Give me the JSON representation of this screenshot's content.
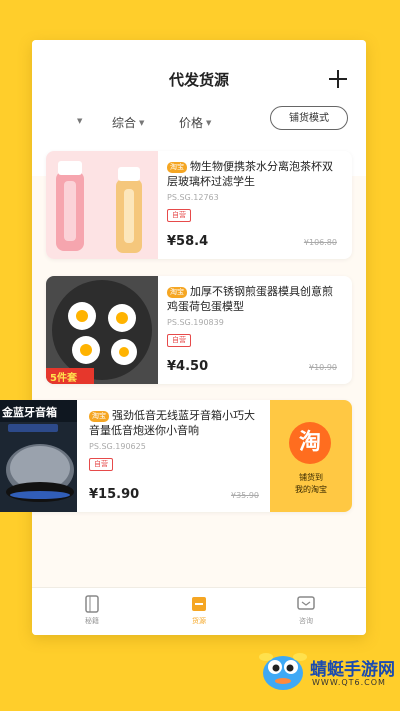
{
  "header": {
    "title": "代发货源"
  },
  "filters": {
    "all": "综合",
    "price": "价格",
    "mode_button": "铺货模式"
  },
  "products": [
    {
      "badge": "淘宝",
      "name": "物生物便携茶水分离泡茶杯双层玻璃杯过滤学生",
      "sku": "PS.SG.12763",
      "tag": "自营",
      "price": "¥58.4",
      "original_price": "¥106.80"
    },
    {
      "badge": "淘宝",
      "name": "加厚不锈钢煎蛋器模具创意煎鸡蛋荷包蛋模型",
      "sku": "PS.SG.190839",
      "tag": "自营",
      "price": "¥4.50",
      "original_price": "¥10.90",
      "image_banner": "5件套"
    },
    {
      "badge": "淘宝",
      "name": "强劲低音无线蓝牙音箱小巧大音量低音炮迷你小音响",
      "sku": "PS.SG.190625",
      "tag": "自营",
      "price": "¥15.90",
      "original_price": "¥35.90",
      "image_banner": "金蓝牙音箱"
    }
  ],
  "taobao_action": {
    "icon_text": "淘",
    "line1": "铺货到",
    "line2": "我的淘宝"
  },
  "tabs": [
    {
      "label": "秘籍",
      "icon": "book-icon"
    },
    {
      "label": "货源",
      "icon": "box-icon",
      "active": true
    },
    {
      "label": "咨询",
      "icon": "chat-icon"
    }
  ],
  "watermark": {
    "name": "蜻蜓手游网",
    "url": "WWW.QT6.COM"
  },
  "colors": {
    "background": "#ffce2b",
    "accent": "#f5a623",
    "taobao": "#ff6d1f",
    "tag_red": "#e64a4a"
  }
}
